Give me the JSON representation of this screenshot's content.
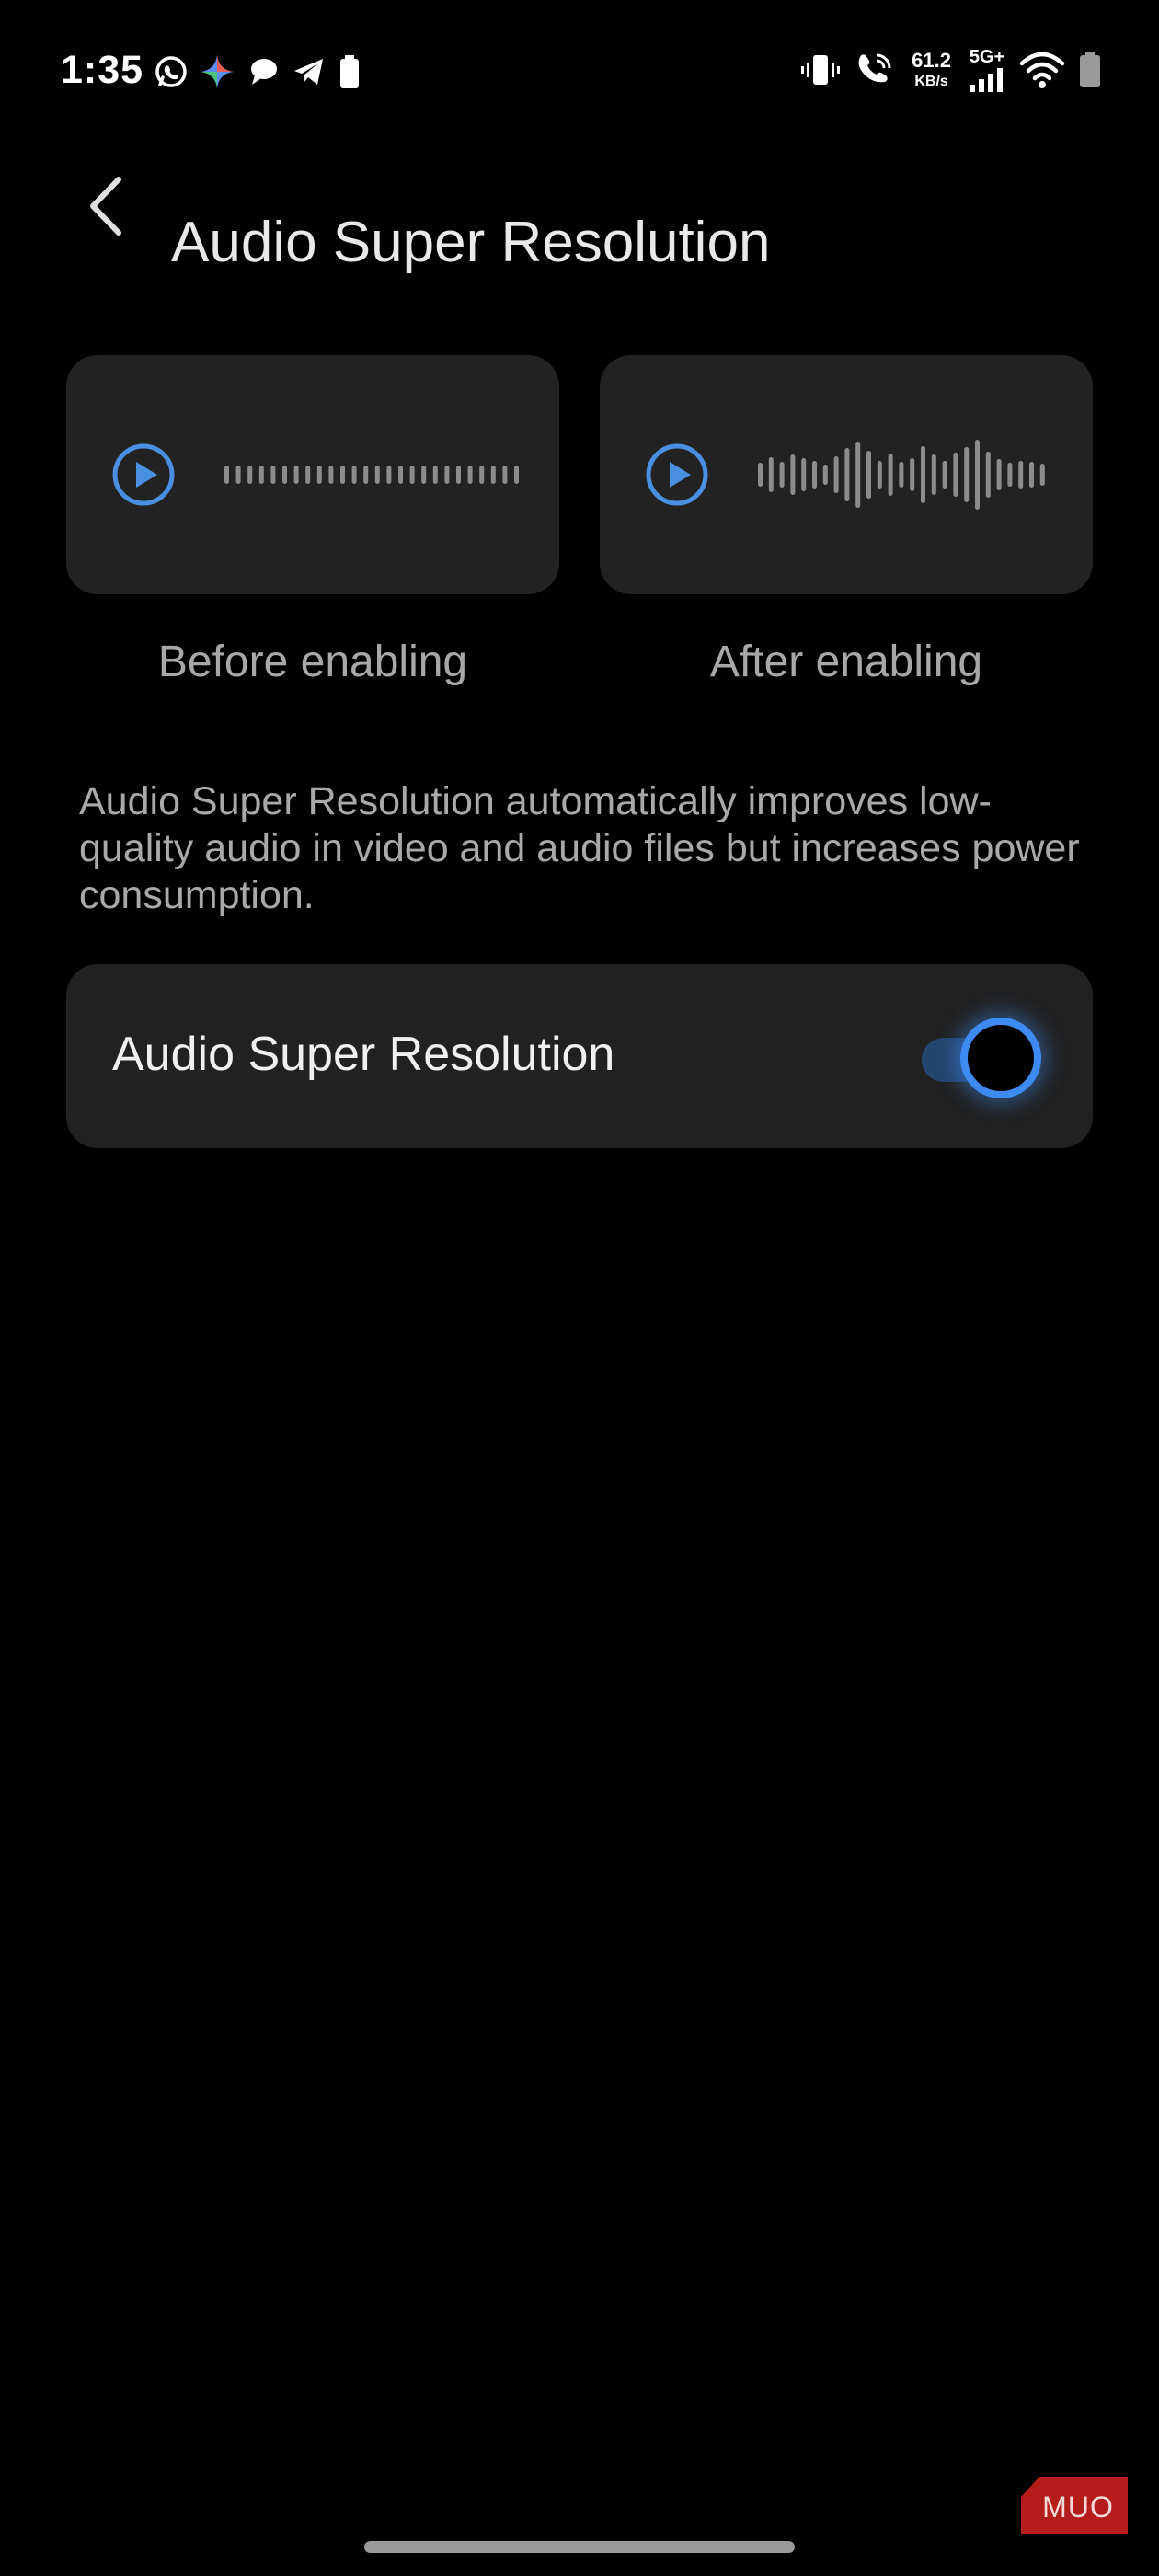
{
  "status_bar": {
    "time": "1:35",
    "net_speed_value": "61.2",
    "net_speed_unit": "KB/s",
    "network_type": "5G+",
    "left_icons": [
      "whatsapp-icon",
      "gemini-icon",
      "chat-icon",
      "telegram-icon",
      "battery-notification-icon"
    ],
    "right_icons": [
      "vibrate-icon",
      "wifi-calling-icon",
      "signal-icon",
      "wifi-icon",
      "battery-icon"
    ]
  },
  "header": {
    "title": "Audio Super Resolution",
    "back_icon": "chevron-left-icon"
  },
  "previews": [
    {
      "label": "Before enabling",
      "icon": "play-icon",
      "waveform": "flat"
    },
    {
      "label": "After enabling",
      "icon": "play-icon",
      "waveform": "dynamic"
    }
  ],
  "description": "Audio Super Resolution automatically improves low-quality audio in video and audio files but increases power consumption.",
  "setting": {
    "label": "Audio Super Resolution",
    "enabled": true
  },
  "watermark": {
    "text": "MUO"
  },
  "colors": {
    "accent": "#3d8bf2",
    "card_background": "#222222",
    "page_background": "#000000",
    "secondary_text": "#a8a8a8",
    "watermark": "#b51c1c"
  }
}
